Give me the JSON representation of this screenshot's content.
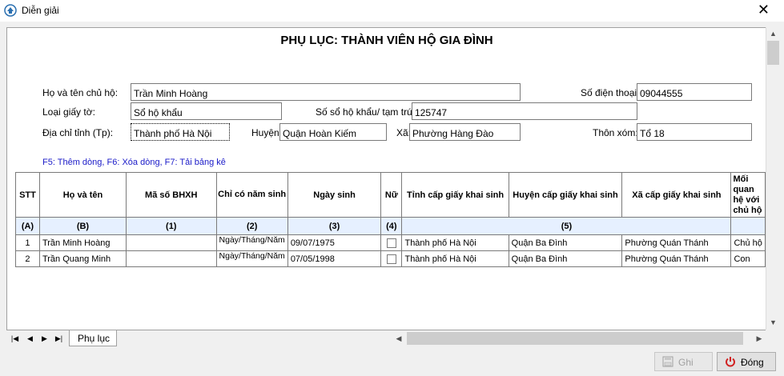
{
  "window": {
    "title": "Diễn giải",
    "close_glyph": "✕"
  },
  "sheet": {
    "heading": "PHỤ LỤC: THÀNH VIÊN HỘ GIA ĐÌNH",
    "form": {
      "owner_label": "Họ và tên chủ hộ:",
      "owner_value": "Trần Minh Hoàng",
      "phone_label": "Số điện thoại:",
      "phone_value": "09044555",
      "doc_type_label": "Loại giấy tờ:",
      "doc_type_value": "Sổ hộ khẩu",
      "book_no_label": "Số sổ hộ khẩu/ tạm trú:",
      "book_no_value": "125747",
      "province_label": "Địa chỉ tỉnh (Tp):",
      "province_value": "Thành phố Hà Nội",
      "district_label": "Huyện:",
      "district_value": "Quận Hoàn Kiếm",
      "ward_label": "Xã:",
      "ward_value": "Phường Hàng Đào",
      "hamlet_label": "Thôn xóm:",
      "hamlet_value": "Tổ 18"
    },
    "hint": "F5: Thêm dòng, F6: Xóa dòng, F7: Tải bảng kê",
    "table": {
      "headers": [
        "STT",
        "Họ và tên",
        "Mã số BHXH",
        "Chỉ có năm sinh",
        "Ngày sinh",
        "Nữ",
        "Tỉnh cấp giấy khai sinh",
        "Huyện cấp giấy khai sinh",
        "Xã cấp giấy khai sinh",
        "Mối quan hệ với chủ hộ"
      ],
      "codes": [
        "(A)",
        "(B)",
        "(1)",
        "(2)",
        "(3)",
        "(4)",
        "(5)"
      ],
      "rows": [
        {
          "stt": "1",
          "name": "Trần Minh Hoàng",
          "bhxh": "",
          "year_only": "Ngày/Tháng/Năm",
          "dob": "09/07/1975",
          "female": false,
          "province": "Thành phố Hà Nội",
          "district": "Quận Ba Đình",
          "ward": "Phường Quán Thánh",
          "relation": "Chủ hộ"
        },
        {
          "stt": "2",
          "name": "Trần Quang Minh",
          "bhxh": "",
          "year_only": "Ngày/Tháng/Năm",
          "dob": "07/05/1998",
          "female": false,
          "province": "Thành phố Hà Nội",
          "district": "Quận Ba Đình",
          "ward": "Phường Quán Thánh",
          "relation": "Con"
        }
      ]
    }
  },
  "tabs": {
    "active": "Phụ lục"
  },
  "buttons": {
    "save": "Ghi",
    "close": "Đóng"
  },
  "icons": [
    "app-icon",
    "close-icon",
    "save-icon",
    "power-icon",
    "first-icon",
    "prev-icon",
    "next-icon",
    "last-icon",
    "arrow-up-icon",
    "arrow-down-icon",
    "arrow-left-icon",
    "arrow-right-icon"
  ],
  "colors": {
    "hint": "#1a1ac8",
    "code_row": "#e6f0ff",
    "close_icon": "#d02020"
  }
}
